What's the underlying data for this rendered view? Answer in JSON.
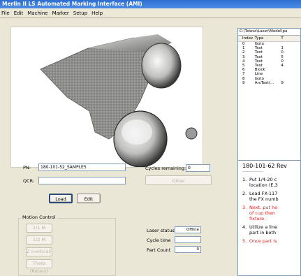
{
  "window": {
    "title": "Merlin II LS Automated Marking Interface (AMI)"
  },
  "menu": [
    "File",
    "Edit",
    "Machine",
    "Marker",
    "Setup",
    "Help"
  ],
  "form": {
    "pn_label": "PN:",
    "pn_value": "180-101-52_SAMPLE5",
    "qcr_label": "QCR:",
    "qcr_value": "",
    "load_button": "Load",
    "edit_button": "Edit",
    "cycles_label": "Cycles remaining:",
    "cycles_value": "0",
    "other_button": "Other"
  },
  "motion_control": {
    "title": "Motion Control",
    "buttons": [
      "1/1 M",
      "1/2 M",
      "Z (vertical)",
      "Theta (Rotary)"
    ]
  },
  "status": {
    "laser_label": "Laser status",
    "laser_value": "Offline",
    "cycle_time_label": "Cycle time",
    "cycle_time_value": "",
    "part_count_label": "Part Count",
    "part_count_value": "0"
  },
  "list_pane": {
    "path": "C:\\Teleso\\Laser\\Medel\\pa",
    "columns": [
      "Index",
      "Type",
      "T"
    ],
    "rows": [
      {
        "index": "0",
        "type": "Goto",
        "t": ""
      },
      {
        "index": "1",
        "type": "Text",
        "t": "1"
      },
      {
        "index": "2",
        "type": "Text",
        "t": "0"
      },
      {
        "index": "3",
        "type": "Text",
        "t": "5"
      },
      {
        "index": "4",
        "type": "Text",
        "t": "0"
      },
      {
        "index": "5",
        "type": "Text",
        "t": "4"
      },
      {
        "index": "6",
        "type": "Block",
        "t": ""
      },
      {
        "index": "7",
        "type": "Line",
        "t": ""
      },
      {
        "index": "8",
        "type": "Goto",
        "t": ""
      },
      {
        "index": "9",
        "type": "ArcText(...",
        "t": "9"
      }
    ]
  },
  "doc_pane": {
    "title": "180-101-62 Rev",
    "separator": "--------------",
    "steps": [
      {
        "num": "1.",
        "lines": [
          "Put 1/4-20 c",
          "location (E,3"
        ],
        "red": false
      },
      {
        "num": "2.",
        "lines": [
          "Load FX-117",
          "the FX numb"
        ],
        "red": false
      },
      {
        "num": "3.",
        "lines": [
          "Next, put ho",
          "of cup then",
          "fixture."
        ],
        "red": true
      },
      {
        "num": "4.",
        "lines": [
          "Utilize a line",
          "part in both"
        ],
        "red": false
      },
      {
        "num": "5.",
        "lines": [
          "Once part is"
        ],
        "red": true
      }
    ]
  },
  "colors": {
    "title_bar": "#2e6fd0",
    "red_text": "#d81e1e"
  }
}
